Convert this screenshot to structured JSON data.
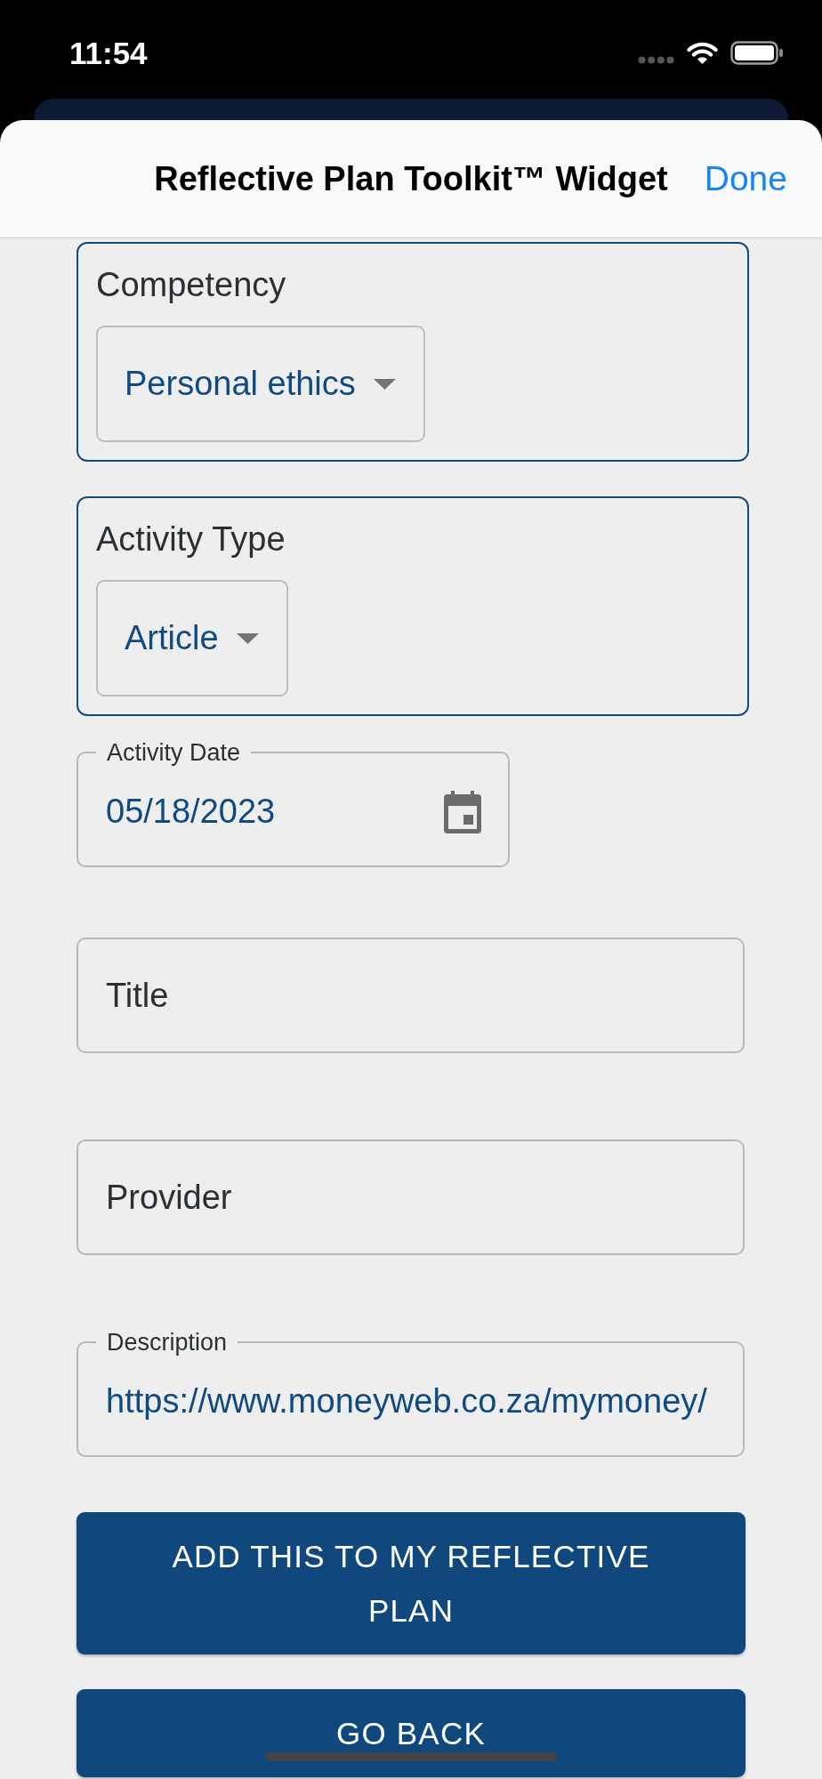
{
  "status_bar": {
    "time": "11:54"
  },
  "sheet": {
    "title": "Reflective Plan Toolkit™ Widget",
    "done": "Done"
  },
  "selects": [
    {
      "label": "Competency",
      "value": "Personal ethics"
    },
    {
      "label": "Activity Type",
      "value": "Article"
    }
  ],
  "fields": [
    {
      "kind": "date",
      "label": "Activity Date",
      "value": "05/18/2023"
    },
    {
      "kind": "text",
      "label": "Title"
    },
    {
      "kind": "text",
      "label": "Provider"
    },
    {
      "kind": "text",
      "label": "Description",
      "value": "https://www.moneyweb.co.za/mymoney/"
    }
  ],
  "buttons": [
    {
      "label": "ADD THIS TO MY REFLECTIVE PLAN"
    },
    {
      "label": "GO BACK"
    }
  ]
}
